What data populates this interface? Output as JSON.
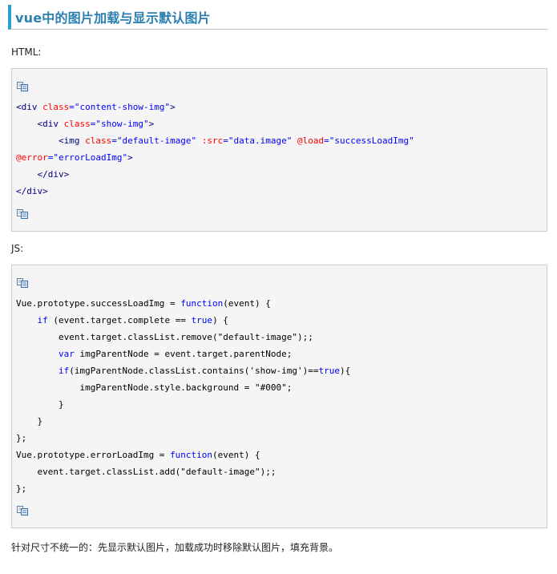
{
  "article": {
    "title": "vue中的图片加载与显示默认图片",
    "html_label": "HTML:",
    "js_label": "JS:",
    "footer": "针对尺寸不统一的：先显示默认图片，加载成功时移除默认图片，填充背景。"
  },
  "icons": {
    "copy": "copy-code-icon"
  },
  "colors": {
    "title": "#2a7fb0",
    "accent": "#2b9fd8",
    "tag": "#000080",
    "attr": "#ff0000",
    "string": "#0000ff",
    "keyword": "#0000ff",
    "plain": "#000000",
    "code_background": "#f5f5f5"
  },
  "html_code": [
    [
      {
        "t": "<div ",
        "c": "tag"
      },
      {
        "t": "class",
        "c": "attr"
      },
      {
        "t": "=\"content-show-img\"",
        "c": "string"
      },
      {
        "t": ">",
        "c": "tag"
      }
    ],
    [
      {
        "t": "    <div ",
        "c": "tag"
      },
      {
        "t": "class",
        "c": "attr"
      },
      {
        "t": "=\"show-img\"",
        "c": "string"
      },
      {
        "t": ">",
        "c": "tag"
      }
    ],
    [
      {
        "t": "        <img ",
        "c": "tag"
      },
      {
        "t": "class",
        "c": "attr"
      },
      {
        "t": "=\"default-image\" ",
        "c": "string"
      },
      {
        "t": ":src",
        "c": "attr"
      },
      {
        "t": "=\"data.image\" ",
        "c": "string"
      },
      {
        "t": "@load",
        "c": "attr"
      },
      {
        "t": "=\"successLoadImg\"",
        "c": "string"
      }
    ],
    [
      {
        "t": "@error",
        "c": "attr"
      },
      {
        "t": "=\"errorLoadImg\"",
        "c": "string"
      },
      {
        "t": ">",
        "c": "tag"
      }
    ],
    [
      {
        "t": "    </div>",
        "c": "tag"
      }
    ],
    [
      {
        "t": "</div>",
        "c": "tag"
      }
    ]
  ],
  "js_code": [
    [
      {
        "t": "Vue.prototype.successLoadImg = ",
        "c": "plain"
      },
      {
        "t": "function",
        "c": "keyword"
      },
      {
        "t": "(event) {",
        "c": "plain"
      }
    ],
    [
      {
        "t": "    ",
        "c": "plain"
      },
      {
        "t": "if",
        "c": "keyword"
      },
      {
        "t": " (event.target.complete == ",
        "c": "plain"
      },
      {
        "t": "true",
        "c": "keyword"
      },
      {
        "t": ") {",
        "c": "plain"
      }
    ],
    [
      {
        "t": "        event.target.classList.remove(\"default-image\");;",
        "c": "plain"
      }
    ],
    [
      {
        "t": "        ",
        "c": "plain"
      },
      {
        "t": "var",
        "c": "keyword"
      },
      {
        "t": " imgParentNode = event.target.parentNode;",
        "c": "plain"
      }
    ],
    [
      {
        "t": "        ",
        "c": "plain"
      },
      {
        "t": "if",
        "c": "keyword"
      },
      {
        "t": "(imgParentNode.classList.contains('show-img')==",
        "c": "plain"
      },
      {
        "t": "true",
        "c": "keyword"
      },
      {
        "t": "){",
        "c": "plain"
      }
    ],
    [
      {
        "t": "            imgParentNode.style.background = \"#000\";",
        "c": "plain"
      }
    ],
    [
      {
        "t": "        }",
        "c": "plain"
      }
    ],
    [
      {
        "t": "    }",
        "c": "plain"
      }
    ],
    [
      {
        "t": "};",
        "c": "plain"
      }
    ],
    [
      {
        "t": "Vue.prototype.errorLoadImg = ",
        "c": "plain"
      },
      {
        "t": "function",
        "c": "keyword"
      },
      {
        "t": "(event) {",
        "c": "plain"
      }
    ],
    [
      {
        "t": "    event.target.classList.add(\"default-image\");;",
        "c": "plain"
      }
    ],
    [
      {
        "t": "};",
        "c": "plain"
      }
    ]
  ]
}
